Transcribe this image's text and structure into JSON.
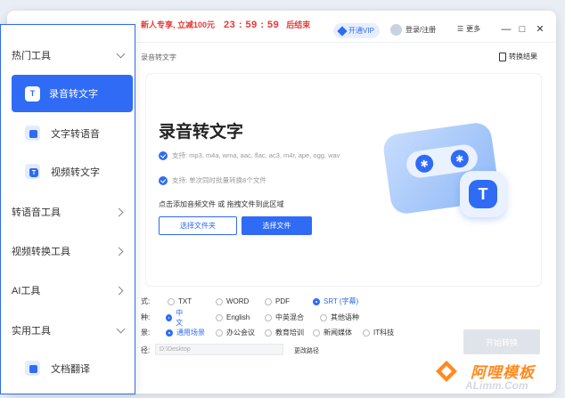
{
  "titlebar": {
    "promo_text": "新人专享, 立减100元",
    "countdown": "23 : 59 : 59",
    "promo_tail": "后结束",
    "vip_label": "开通VIP",
    "login_label": "登录/注册",
    "more_label": "更多",
    "minimize": "—",
    "maximize": "□",
    "close": "✕"
  },
  "breadcrumb": "录音转文字",
  "result_link": "转换结果",
  "main": {
    "title": "录音转文字",
    "features": [
      "支持: mp3, m4a, wma, aac, flac, ac3, m4r, ape, ogg, wav",
      "支持: 单次同时批量转换8个文件"
    ],
    "drop_hint": "点击添加音频文件 或 拖拽文件到此区域",
    "btn_folder": "选择文件夹",
    "btn_file": "选择文件"
  },
  "options": {
    "format": {
      "label": "式:",
      "choices": [
        "TXT",
        "WORD",
        "PDF",
        "SRT (字幕)"
      ],
      "selected": "SRT (字幕)"
    },
    "language": {
      "label": "种:",
      "choices": [
        "中文",
        "English",
        "中英混合",
        "其他语种"
      ],
      "selected": "中文"
    },
    "scene": {
      "label": "景:",
      "choices": [
        "通用场景",
        "办公会议",
        "教育培训",
        "新闻媒体",
        "IT科技"
      ],
      "selected": "通用场景"
    },
    "path": {
      "label": "径:",
      "value": "D:\\Desktop",
      "change_label": "更改路径"
    }
  },
  "start_button": "开始转换",
  "sidebar": {
    "groups": [
      {
        "label": "热门工具",
        "expanded": true
      },
      {
        "label": "转语音工具",
        "expanded": false
      },
      {
        "label": "视频转换工具",
        "expanded": false
      },
      {
        "label": "AI工具",
        "expanded": false
      },
      {
        "label": "实用工具",
        "expanded": true
      }
    ],
    "items": [
      {
        "label": "录音转文字",
        "active": true
      },
      {
        "label": "文字转语音",
        "active": false
      },
      {
        "label": "视频转文字",
        "active": false
      },
      {
        "label": "文档翻译",
        "active": false
      }
    ]
  },
  "watermark": {
    "title": "阿哩模板",
    "url": "ALimm.Com"
  },
  "colors": {
    "accent": "#2f6bf5",
    "promo": "#e53935",
    "watermark": "#ff8a1f"
  }
}
